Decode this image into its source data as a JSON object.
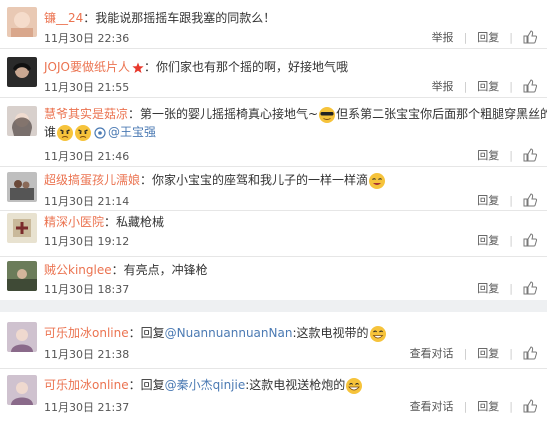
{
  "colors": {
    "name": "#eb7350",
    "link": "#4b7ab3",
    "gap": "#eef0f2"
  },
  "comments": [
    {
      "name": "镰__24",
      "text": "：我能说那摇摇车跟我塞的同款么！",
      "time": "11月30日 22:36",
      "report": "举报",
      "reply": "回复"
    },
    {
      "name": "JOJO要做纸片人",
      "text": "：你们家也有那个摇的啊，好接地气哦",
      "time": "11月30日 21:55",
      "report": "举报",
      "reply": "回复"
    },
    {
      "name": "慧爷其实是菇凉",
      "text": "：第一张的婴儿摇摇椅真心接地气~",
      "text2": "但系第二张宝宝你后面那个粗腿穿黑丝的是",
      "text3": "谁",
      "mention": "@王宝强",
      "time": "11月30日 21:46",
      "reply": "回复"
    },
    {
      "name": "超级搞蛋孩儿濡娘",
      "text": "：你家小宝宝的座驾和我儿子的一样一样滴",
      "time": "11月30日 21:14",
      "reply": "回复"
    },
    {
      "name": "精深小医院",
      "text": "：私藏枪械",
      "time": "11月30日 19:12",
      "reply": "回复"
    },
    {
      "name": "贼公kinglee",
      "text": "：有亮点，冲锋枪",
      "time": "11月30日 18:37",
      "reply": "回复"
    }
  ],
  "replies": [
    {
      "name": "可乐加冰online",
      "prefix": "：回复",
      "mention": "@NuannuannuanNan",
      "text": ":这款电视带的",
      "time": "11月30日 21:38",
      "view": "查看对话",
      "reply": "回复"
    },
    {
      "name": "可乐加冰online",
      "prefix": "：回复",
      "mention": "@秦小杰qinjie",
      "text": ":这款电视送枪炮的",
      "time": "11月30日 21:37",
      "view": "查看对话",
      "reply": "回复"
    }
  ]
}
